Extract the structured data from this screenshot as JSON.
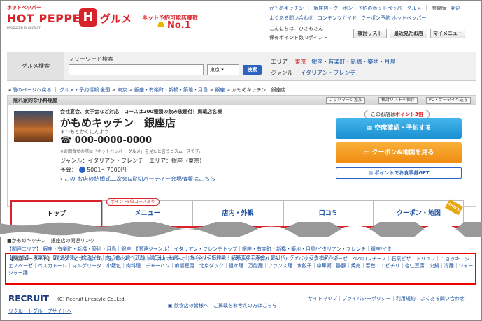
{
  "header": {
    "logo_small": "ホットペッパー",
    "logo_big": "HOT PEPPER",
    "logo_sub": "PRODUCED BY RECRUIT",
    "logo_h": "H",
    "logo_gourmet": "グルメ",
    "promo_line": "ネット予約可能店舗数",
    "promo_no1": "No.1",
    "toplinks_row1": [
      "かもめキッチン",
      "銀座店・クーポン・予約のホットペッパーグルメ",
      "関東版",
      "変更"
    ],
    "toplinks_row2": [
      "よくある問い合わせ",
      "コンテンツガイド",
      "クーポン予約 ホットペッパー"
    ],
    "greeting": "こんにちは、ひさもさん",
    "points": "保有ポイント数 0ポイント",
    "buttons": [
      "検討リスト",
      "最近見たお店",
      "マイメニュー"
    ]
  },
  "search": {
    "label": "グルメ検索",
    "free_label": "フリーワード検索",
    "input_value": "",
    "region": "東京",
    "button": "検索",
    "area_label": "エリア",
    "area_value_red": "東京",
    "area_value": "銀座・有楽町・新橋・築地・月島",
    "genre_label": "ジャンル",
    "genre_value": "イタリアン・フレンチ"
  },
  "breadcrumb": [
    "前のページへ戻る",
    "グルメ・予約情報 全国",
    "東京",
    "銀座・有楽町・新橋・築地・月島",
    "銀座",
    "かもめキッチン　銀座店"
  ],
  "store": {
    "head_title": "隠れ家的な小料理屋",
    "head_buttons": [
      "ブックマーク追加",
      "検討リストへ保存",
      "PC・ケータイへ送る"
    ],
    "tagline": "会社宴会、女子会など対応　コースは200種類の飲み放題付！掲載店名様",
    "name": "かもめキッチン　銀座店",
    "kana": "まつもとかくにんよう",
    "tel": "000-0000-0000",
    "tel_note": "※お問合せの際は「ホットペッパー グルメ」を見たと言うとスムーズです。",
    "genre": "ジャンル：イタリアン・フレンチ　エリア：銀座（東京）",
    "budget_label": "予算：",
    "budget_value": "5001〜7000円",
    "link": "この お店の結婚式二次会&貸切パーティー会場情報はこちら",
    "point_note_pre": "このお店は",
    "point_note_red": "ポイント3倍",
    "cta_reserve": "空席確認・予約する",
    "cta_coupon": "クーポン&地図を見る",
    "cta_ticket": "ポイントでお食事券GET"
  },
  "tabs": {
    "items": [
      "トップ",
      "メニュー",
      "店内・外観",
      "口コミ",
      "クーポン・地図"
    ],
    "badge": "ポイント5倍コースあり",
    "check": "CHECK"
  },
  "lower": {
    "line1": "■かもめキッチン　銀座店の関連リンク",
    "line2": "【関連エリア】 銀座・有楽町・新橋・築地・月島｜銀座　【関連ジャンル】 イタリアン・フレンチトップ｜銀座・有楽町・新橋・築地・月島/イタリアン・フレンチ｜銀座/イタ",
    "line3": "【関連駅】 東京駅　【関連特集】 歓送迎会｜女子会｜食べ放題｜誕生日・記念日｜ポイント3倍特集｜結婚式の二次会、貸切パーティー｜ご当地グルメ",
    "kw_label": "【関連キーワード】",
    "keywords": "パスタ｜ピザ｜生ハム｜生パスタ｜リゾット｜カルボナーラ｜キッシュ｜バーニャカウダ｜冷製パスタ｜アクアパッツァ｜ボロネーゼ｜ペペロンチーノ｜石窯ピザ｜トリュフ｜ニョッキ｜ジェノベーゼ｜ペスカトーレ｜マルゲリータ｜小籠包｜肉料理｜チャーハン｜麻婆豆腐｜北京ダック｜担々麺｜万能麺｜フランス麺｜水餃子｜中華粥｜酢豚｜焼売｜春巻｜エビチリ｜杏仁豆腐｜火鍋｜冷麺｜ジャージャー麺"
  },
  "footer": {
    "recruit": "RECRUIT",
    "copyright": "(C) Recruit Lifestyle Co.,Ltd.",
    "group": "リクルートグループサイトへ",
    "mid": "飲食店の皆様へ　ご掲載をお考えの方はこちら",
    "right": "サイトマップ｜プライバシーポリシー｜利用規約｜よくある問い合わせ"
  }
}
